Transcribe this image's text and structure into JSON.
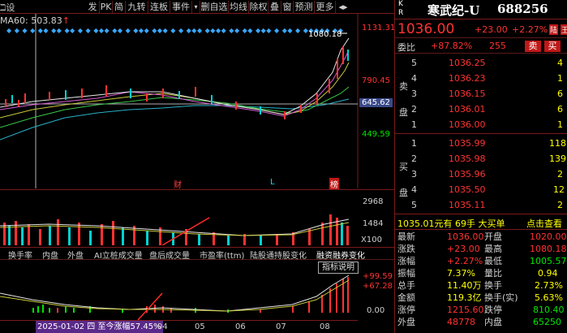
{
  "toolbar": {
    "items": [
      "发",
      "PK",
      "简",
      "九转",
      "连板",
      "事件",
      "▾",
      "删自选",
      "均线",
      "除权",
      "叠",
      "窗",
      "预测",
      "更多",
      "◂▸"
    ],
    "left_label": "ℶ设"
  },
  "price_chart": {
    "ma_label": "MA60: 503.83",
    "ma_arrow": "↑",
    "high_marker": "1080.18",
    "marker_diamonds": "◆ ◆ ◆ ◆ ◆◆ ◆◆ ◆◆ ◆ ◆ ◆◆◆ ◆◆ ◆ ◆◆◆ ◆◆◆ ◆ ◆ ◆◆◆ ◆◆◆◆ ◆◆ ◆◆ ◆◆◆ ◆ ◆◆ ◆ ◆◆◆◆◆ ◆◆",
    "right_axis": [
      "1131.31",
      "790.45",
      "645.62",
      "449.59"
    ],
    "tags": [
      "财",
      "L",
      "榜"
    ]
  },
  "volume_chart": {
    "axis": [
      "2968",
      "1484",
      "X100"
    ]
  },
  "indicator_tabs": [
    "换手率",
    "内盘",
    "外盘",
    "AI立桩成交量",
    "盘后成交量",
    "市盈率(ttm)",
    "陆股通持股变化",
    "融资融券变化"
  ],
  "indicator_button": "指标说明",
  "indicator_chart": {
    "axis": [
      "+99.59",
      "+67.28",
      "0.00"
    ],
    "x_labels": [
      "04",
      "05",
      "06",
      "07",
      "08"
    ],
    "range_text": "2025-01-02 四 至今涨幅57.45%"
  },
  "quote": {
    "mode_k": "K",
    "mode_r": "R",
    "name": "寒武纪-U",
    "code": "688256",
    "price": "1036.00",
    "change": "+23.00",
    "change_pct": "+2.27%",
    "connect_badge": "陆",
    "margin_badge": "王",
    "weibi_label": "委比",
    "weibi_value": "+87.82%",
    "weicha_value": "255",
    "sell_button": "卖",
    "buy_button": "买",
    "sell_side_label": "卖盘",
    "buy_side_label": "买盘",
    "asks": [
      {
        "level": "5",
        "price": "1036.25",
        "vol": "4"
      },
      {
        "level": "4",
        "price": "1036.23",
        "vol": "1"
      },
      {
        "level": "3",
        "price": "1036.15",
        "vol": "6"
      },
      {
        "level": "2",
        "price": "1036.01",
        "vol": "6"
      },
      {
        "level": "1",
        "price": "1036.00",
        "vol": "1"
      }
    ],
    "bids": [
      {
        "level": "1",
        "price": "1035.99",
        "vol": "118"
      },
      {
        "level": "2",
        "price": "1035.98",
        "vol": "139"
      },
      {
        "level": "3",
        "price": "1035.96",
        "vol": "2"
      },
      {
        "level": "4",
        "price": "1035.50",
        "vol": "12"
      },
      {
        "level": "5",
        "price": "1035.11",
        "vol": "2"
      }
    ],
    "best_bid_line": "1035.01元有 69手 大买单",
    "click_view": "点击查看",
    "stats": [
      {
        "k1": "最新",
        "v1": "1036.00",
        "k2": "开盘",
        "v2": "1020.00",
        "c1": "red",
        "c2": "red"
      },
      {
        "k1": "涨跌",
        "v1": "+23.00",
        "k2": "最高",
        "v2": "1080.18",
        "c1": "red",
        "c2": "red"
      },
      {
        "k1": "涨幅",
        "v1": "+2.27%",
        "k2": "最低",
        "v2": "1005.57",
        "c1": "red",
        "c2": "green"
      },
      {
        "k1": "振幅",
        "v1": "7.37%",
        "k2": "量比",
        "v2": "0.94",
        "c1": "yellow",
        "c2": "yellow"
      },
      {
        "k1": "总手",
        "v1": "11.40万",
        "k2": "换手",
        "v2": "2.73%",
        "c1": "yellow",
        "c2": "yellow"
      },
      {
        "k1": "金额",
        "v1": "119.3亿",
        "k2": "换手(实)",
        "v2": "5.63%",
        "c1": "yellow",
        "c2": "yellow"
      },
      {
        "k1": "涨停",
        "v1": "1215.60",
        "k2": "跌停",
        "v2": "810.40",
        "c1": "red",
        "c2": "green"
      },
      {
        "k1": "外盘",
        "v1": "48778",
        "k2": "内盘",
        "v2": "65250",
        "c1": "red",
        "c2": "green"
      }
    ]
  }
}
